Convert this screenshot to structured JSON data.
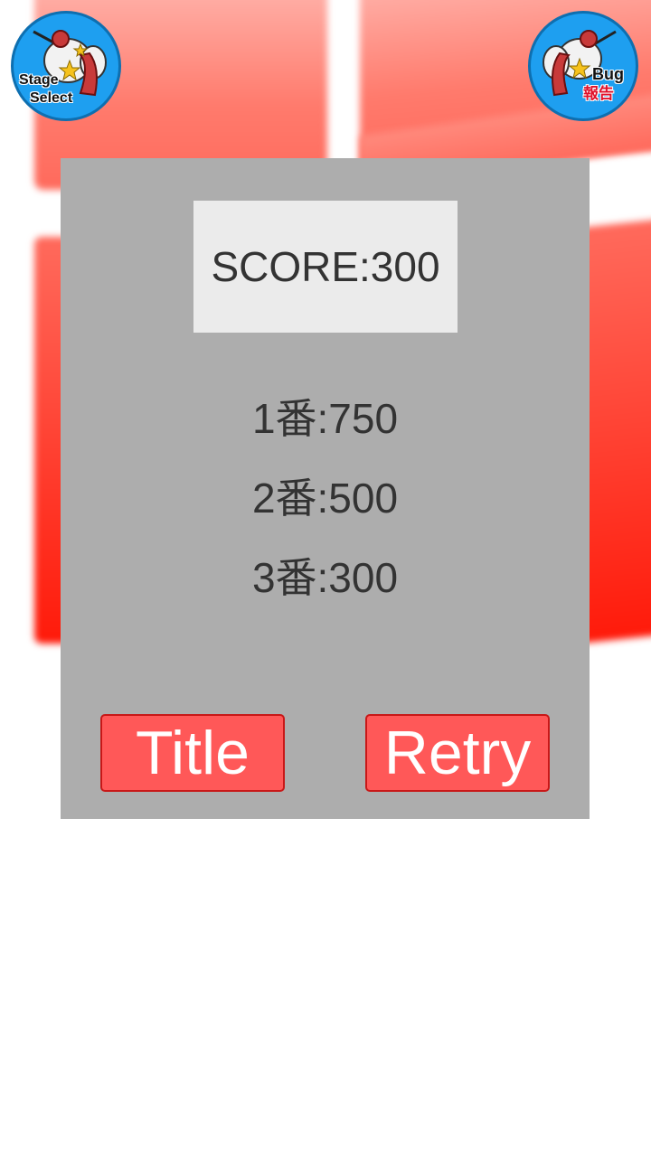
{
  "header": {
    "stage_select": {
      "label_line1": "Stage",
      "label_line2": "Select",
      "icon": "stage-select-icon"
    },
    "bug_report": {
      "label_line1": "Bug",
      "label_line2": "報告",
      "icon": "bug-report-icon"
    }
  },
  "result": {
    "score_text": "SCORE:300",
    "ranking": [
      {
        "text": "1番:750"
      },
      {
        "text": "2番:500"
      },
      {
        "text": "3番:300"
      }
    ]
  },
  "buttons": {
    "title_label": "Title",
    "retry_label": "Retry"
  },
  "colors": {
    "panel": "#adadad",
    "score_box": "#ebebeb",
    "button": "#ff5858",
    "corner_button": "#1e9ff0",
    "background_blocks": "#ff2a1a"
  }
}
